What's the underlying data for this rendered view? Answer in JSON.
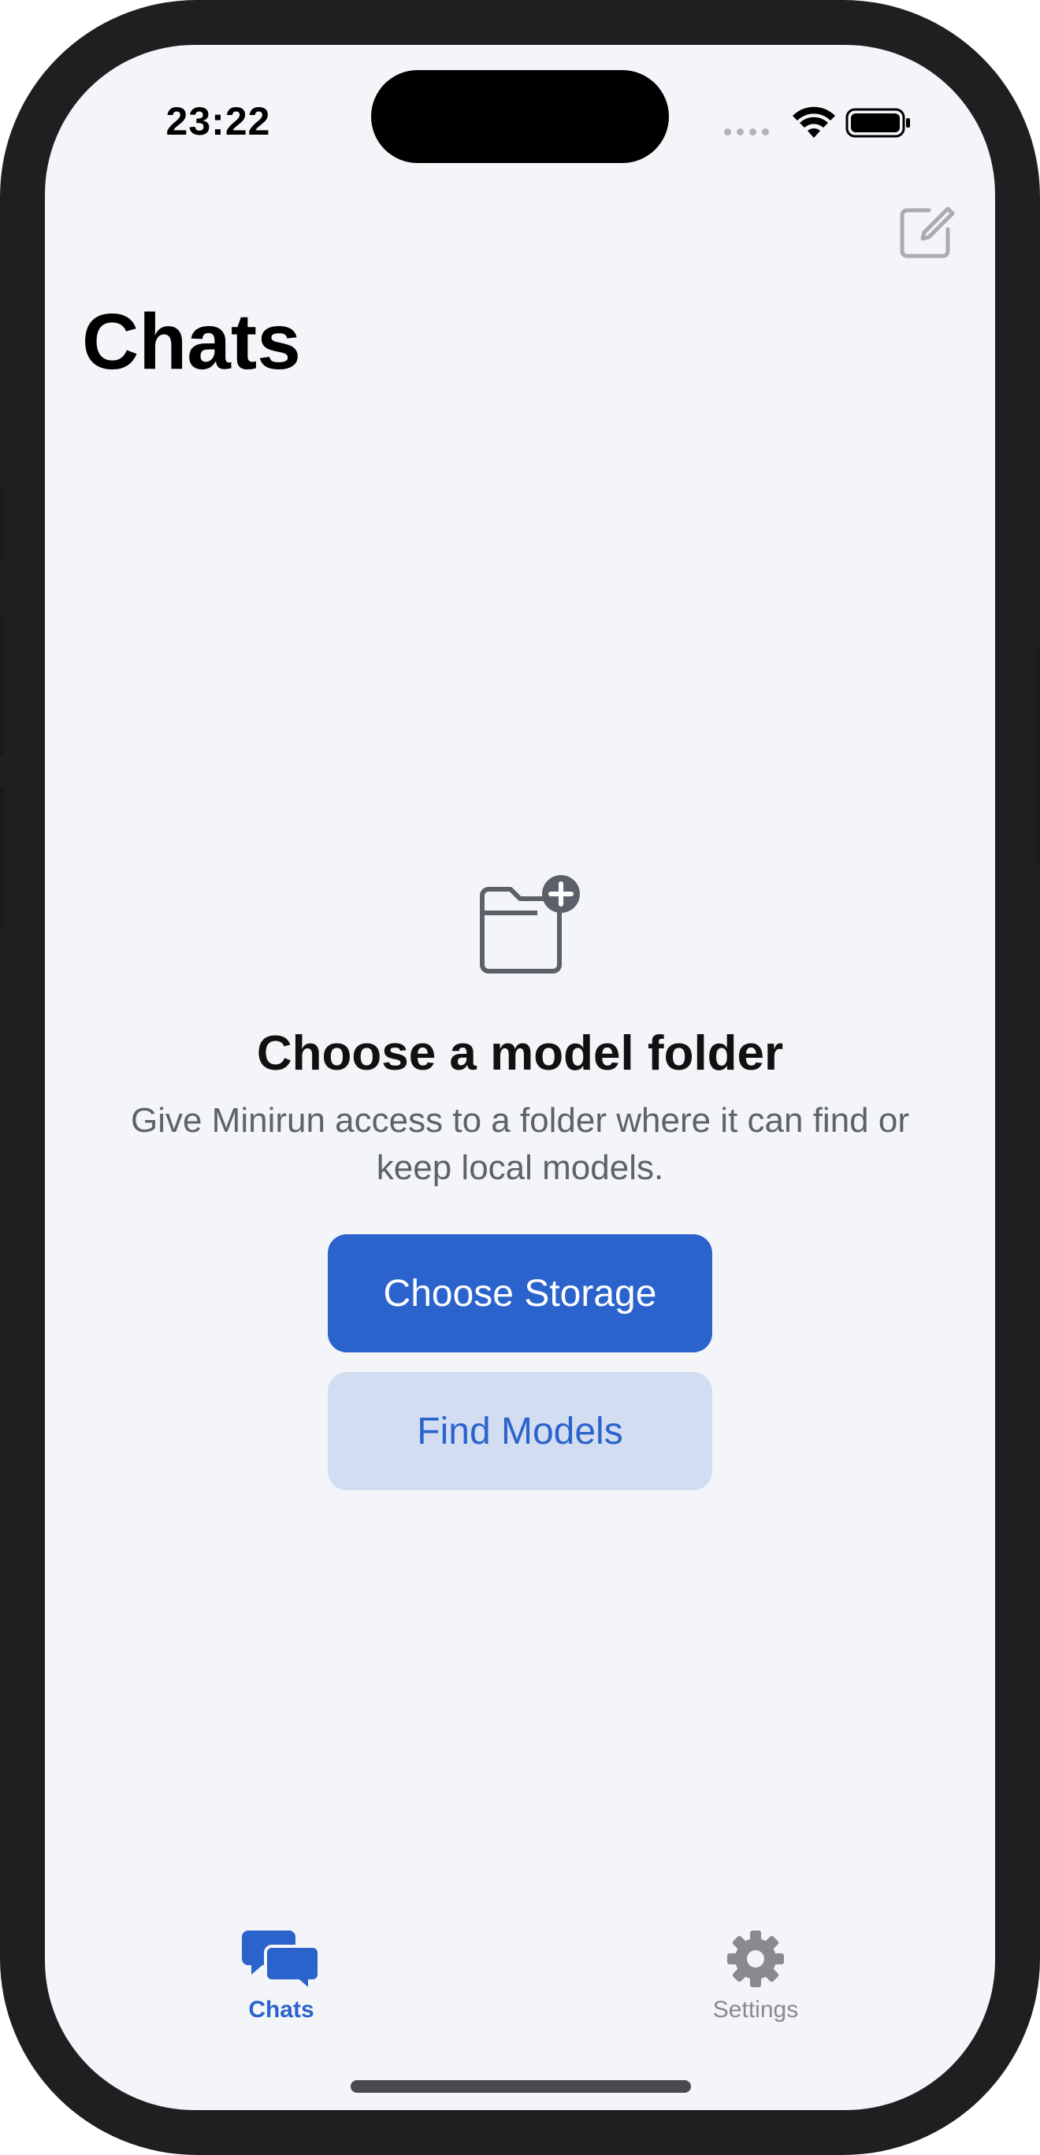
{
  "status_bar": {
    "time": "23:22"
  },
  "header": {
    "title": "Chats",
    "compose_icon": "compose-icon"
  },
  "empty_state": {
    "icon": "folder-plus-icon",
    "title": "Choose a model folder",
    "description": "Give Minirun access to a folder where it can find or keep local models.",
    "primary_button": "Choose Storage",
    "secondary_button": "Find Models"
  },
  "tab_bar": {
    "items": [
      {
        "label": "Chats",
        "icon": "chat-bubbles-icon",
        "selected": true
      },
      {
        "label": "Settings",
        "icon": "gear-icon",
        "selected": false
      }
    ]
  },
  "colors": {
    "accent": "#2b63cc",
    "accent_light": "#d3ddf1",
    "background": "#f4f5f8",
    "inactive": "#8a8a8e"
  }
}
